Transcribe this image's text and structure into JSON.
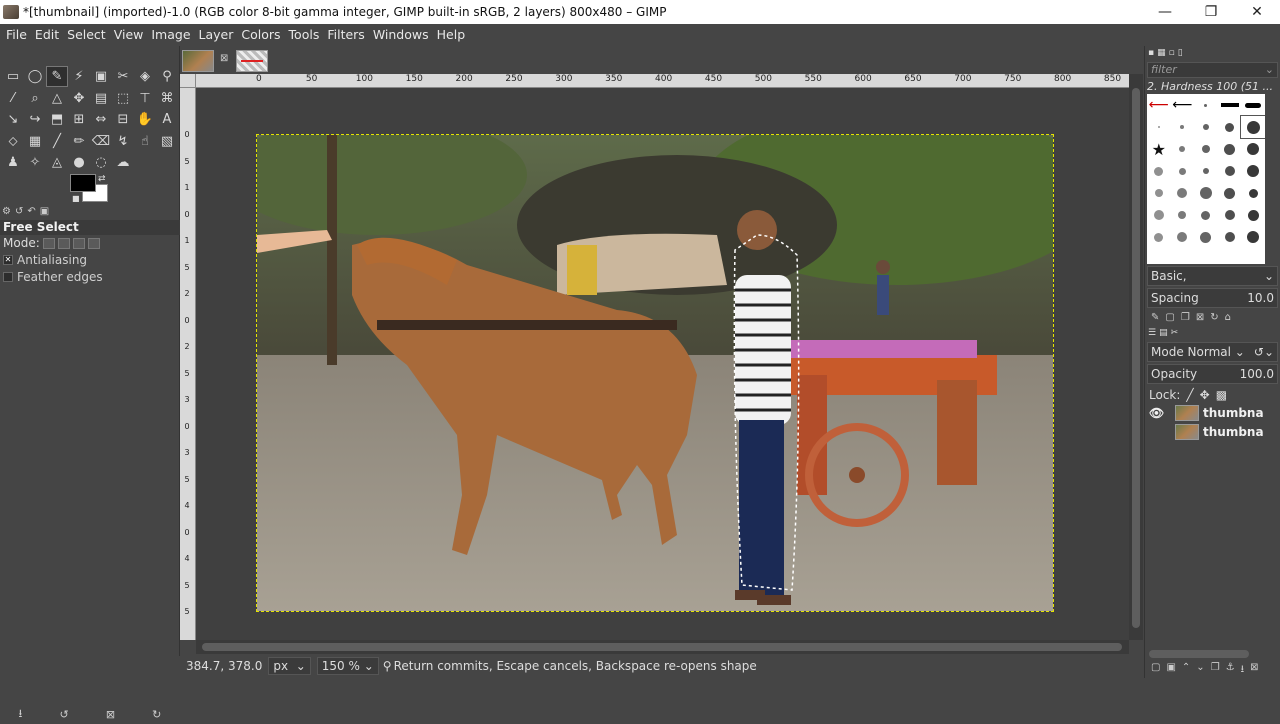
{
  "window": {
    "title": "*[thumbnail] (imported)-1.0 (RGB color 8-bit gamma integer, GIMP built-in sRGB, 2 layers) 800x480 – GIMP",
    "minimize": "—",
    "maximize": "❐",
    "close": "✕"
  },
  "menu": [
    "File",
    "Edit",
    "Select",
    "View",
    "Image",
    "Layer",
    "Colors",
    "Tools",
    "Filters",
    "Windows",
    "Help"
  ],
  "tools": [
    "▭",
    "◯",
    "✎",
    "⚡",
    "▣",
    "✂",
    "◈",
    "⚲",
    "⁄",
    "⌕",
    "△",
    "✥",
    "▤",
    "⬚",
    "⊤",
    "⌘",
    "↘",
    "↪",
    "⬒",
    "⊞",
    "⇔",
    "⊟",
    "✋",
    "A",
    "⬦",
    "▦",
    "╱",
    "✏",
    "⌫",
    "↯",
    "☝",
    "▧",
    "♟",
    "✧",
    "◬",
    "●",
    "◌",
    "☁"
  ],
  "tool_options": {
    "title": "Free Select",
    "mode_label": "Mode:",
    "antialiasing": "Antialiasing",
    "feather": "Feather edges"
  },
  "ruler_top": [
    "0",
    "50",
    "100",
    "150",
    "200",
    "250",
    "300",
    "350",
    "400",
    "450",
    "500",
    "550",
    "600",
    "650",
    "700",
    "750",
    "800",
    "850"
  ],
  "ruler_left": [
    "0",
    "5",
    "1",
    "0",
    "1",
    "5",
    "2",
    "0",
    "2",
    "5",
    "3",
    "0",
    "3",
    "5",
    "4",
    "0",
    "4",
    "5",
    "5"
  ],
  "status": {
    "coords": "384.7, 378.0",
    "unit": "px",
    "zoom": "150 %",
    "message": "Return commits, Escape cancels, Backspace re-opens shape"
  },
  "dock": {
    "filter_placeholder": "filter",
    "brush_name": "2. Hardness 100 (51 ...",
    "brush_preset": "Basic,",
    "spacing_label": "Spacing",
    "spacing_value": "10.0",
    "mode_label": "Mode",
    "mode_value": "Normal",
    "opacity_label": "Opacity",
    "opacity_value": "100.0",
    "lock_label": "Lock:",
    "layers": [
      "thumbna",
      "thumbna"
    ]
  },
  "colors": {
    "ui_bg": "#454545",
    "selection": "#e4e400",
    "foreground": "#000000",
    "background": "#ffffff"
  }
}
